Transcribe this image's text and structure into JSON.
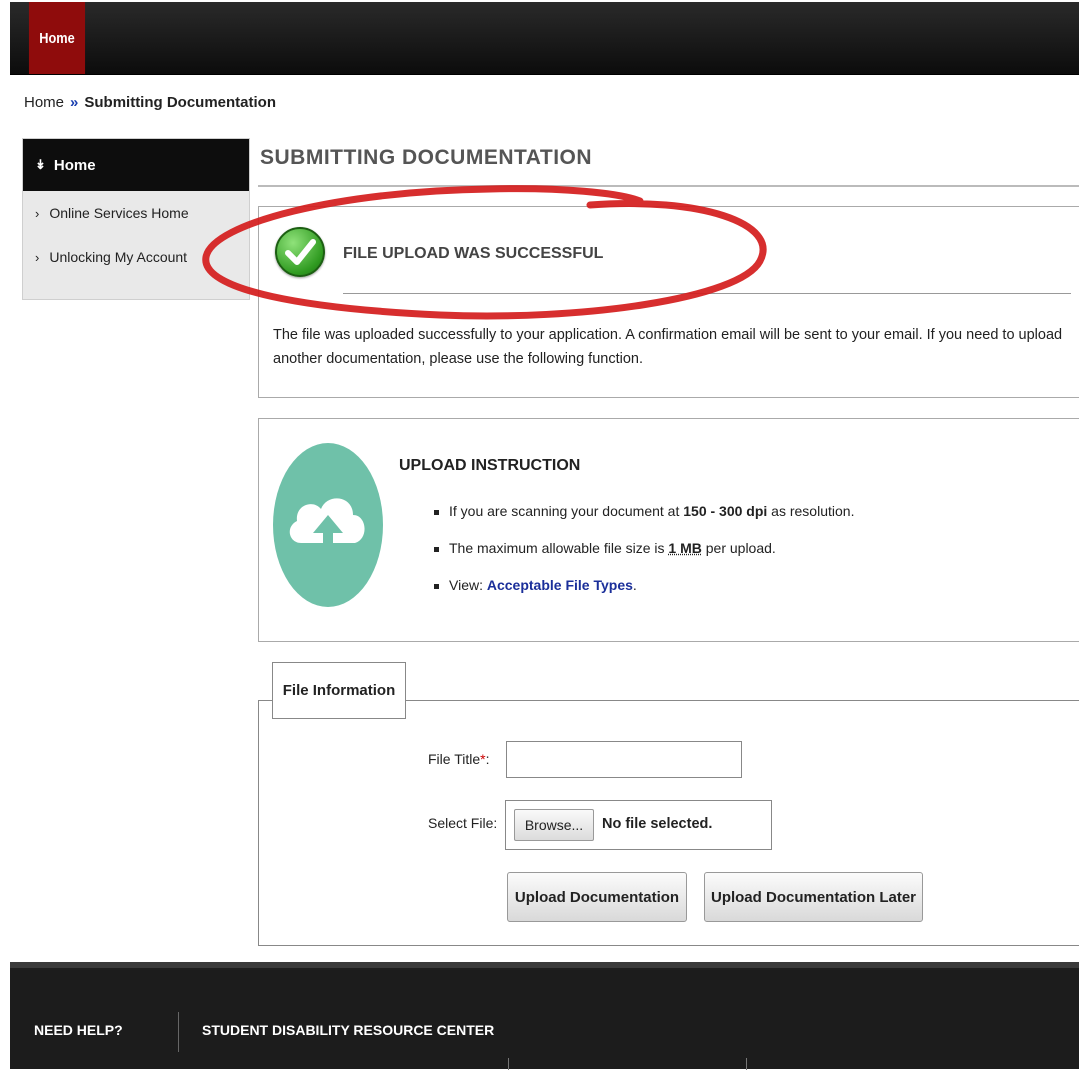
{
  "nav": {
    "home_label": "Home"
  },
  "breadcrumb": {
    "root": "Home",
    "separator": "»",
    "current": "Submitting Documentation"
  },
  "sidebar": {
    "header_label": "Home",
    "items": [
      {
        "label": "Online Services Home"
      },
      {
        "label": "Unlocking My Account"
      }
    ]
  },
  "main": {
    "title": "SUBMITTING DOCUMENTATION",
    "success": {
      "title": "FILE UPLOAD WAS SUCCESSFUL",
      "message": "The file was uploaded successfully to your application. A confirmation email will be sent to your email. If you need to upload another documentation, please use the following function."
    },
    "instructions": {
      "title": "UPLOAD INSTRUCTION",
      "item1_pre": "If you are scanning your document at ",
      "item1_bold": "150 - 300 dpi",
      "item1_post": " as resolution.",
      "item2_pre": "The maximum allowable file size is ",
      "item2_bold": "1 MB",
      "item2_post": " per upload.",
      "item3_pre": "View: ",
      "item3_link": "Acceptable File Types",
      "item3_post": "."
    },
    "file_info": {
      "legend": "File Information",
      "title_label": "File Title",
      "required_mark": "*",
      "title_suffix": ":",
      "title_value": "",
      "select_label": "Select File:",
      "browse_label": "Browse...",
      "no_file_text": "No file selected.",
      "upload_button": "Upload Documentation",
      "upload_later_button": "Upload Documentation Later"
    }
  },
  "footer": {
    "help_label": "NEED HELP?",
    "center_label": "STUDENT DISABILITY RESOURCE CENTER"
  },
  "colors": {
    "nav_home_bg": "#8f0c0c",
    "link_blue": "#1b2f9a",
    "success_green": "#2f9a20",
    "cloud_teal": "#6fc1a9",
    "annotation_red": "#d41c1c"
  }
}
